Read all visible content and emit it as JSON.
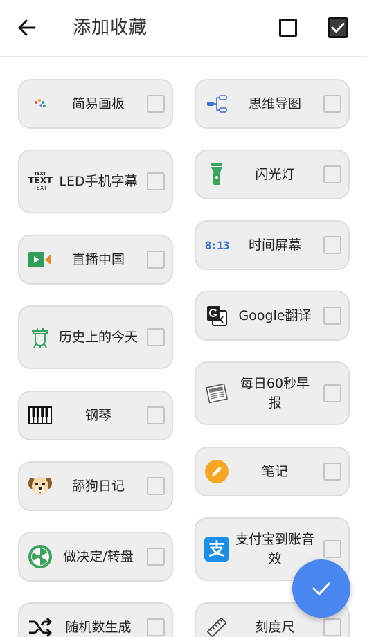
{
  "header": {
    "title": "添加收藏"
  },
  "items": [
    {
      "label": "简易画板",
      "icon": "palette-icon"
    },
    {
      "label": "思维导图",
      "icon": "mindmap-icon"
    },
    {
      "label": "LED手机字幕",
      "icon": "led-text-icon",
      "icon_text": [
        "TEXT",
        "TEXT",
        "TEXT"
      ]
    },
    {
      "label": "闪光灯",
      "icon": "flashlight-icon"
    },
    {
      "label": "直播中国",
      "icon": "live-video-icon"
    },
    {
      "label": "时间屏幕",
      "icon": "clock-digits-icon",
      "icon_text": "8:13"
    },
    {
      "label": "历史上的今天",
      "icon": "history-icon"
    },
    {
      "label": "Google翻译",
      "icon": "google-translate-icon"
    },
    {
      "label": "钢琴",
      "icon": "piano-icon"
    },
    {
      "label": "每日60秒早报",
      "icon": "newspaper-icon",
      "icon_text": "NEWS"
    },
    {
      "label": "舔狗日记",
      "icon": "dog-icon"
    },
    {
      "label": "笔记",
      "icon": "note-pencil-icon"
    },
    {
      "label": "做决定/转盘",
      "icon": "wheel-icon"
    },
    {
      "label": "支付宝到账音效",
      "icon": "alipay-icon",
      "icon_text": "支"
    },
    {
      "label": "随机数生成",
      "icon": "shuffle-icon"
    },
    {
      "label": "刻度尺",
      "icon": "ruler-icon"
    }
  ],
  "colors": {
    "fab": "#4a86ef",
    "card_bg": "#eeeeee",
    "green": "#3aa35c",
    "alipay": "#1a8ee8",
    "note": "#f5a623"
  }
}
